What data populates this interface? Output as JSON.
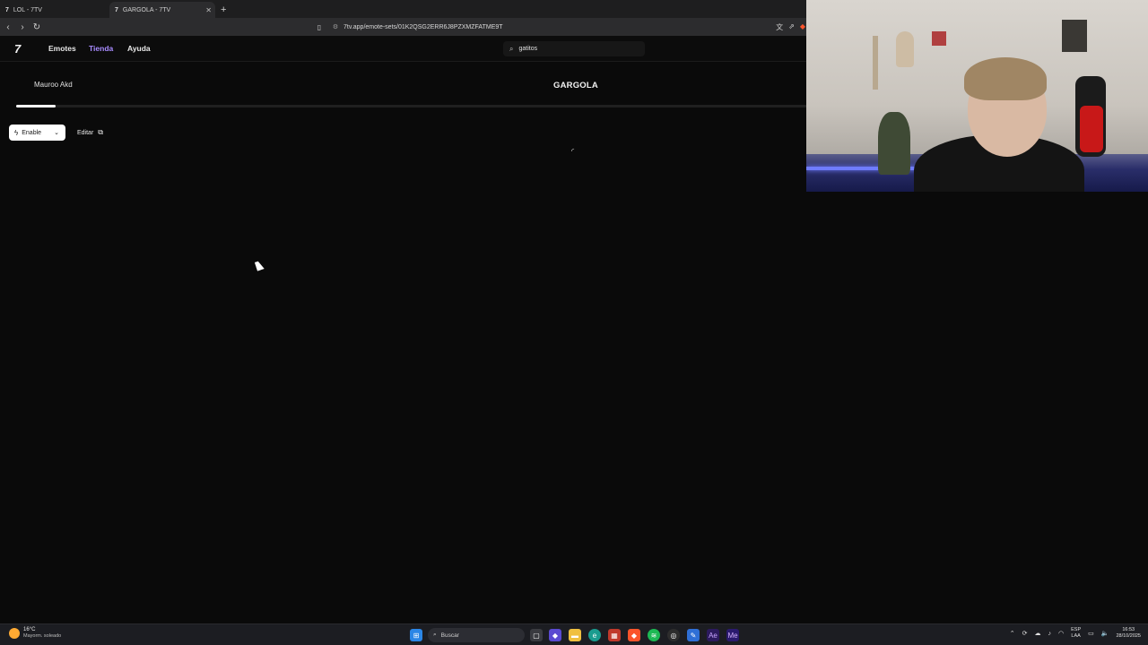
{
  "browser": {
    "tabs": [
      {
        "icon": "7tv-favicon",
        "title": "LOL - 7TV",
        "active": false
      },
      {
        "icon": "7tv-favicon",
        "title": "GARGOLA - 7TV",
        "active": true
      }
    ],
    "url": "7tv.app/emote-sets/01K2QSG2ERR6J8PZXMZFATME9T"
  },
  "app": {
    "logo": "7",
    "nav": {
      "emotes": "Emotes",
      "store": "Tienda",
      "help": "Ayuda"
    },
    "search_value": "gatitos",
    "accent_color": "#a88bff"
  },
  "emote_set": {
    "owner": "Mauroo Akd",
    "title": "GARGOLA",
    "capacity_fraction": 0.05,
    "enable_label": "Enable",
    "edit_label": "Editar"
  },
  "taskbar": {
    "weather_temp": "16°C",
    "weather_condition": "Mayorm. soleado",
    "search_placeholder": "Buscar",
    "lang_top": "ESP",
    "lang_bottom": "LAA",
    "time": "16:53",
    "date": "28/10/2025"
  }
}
